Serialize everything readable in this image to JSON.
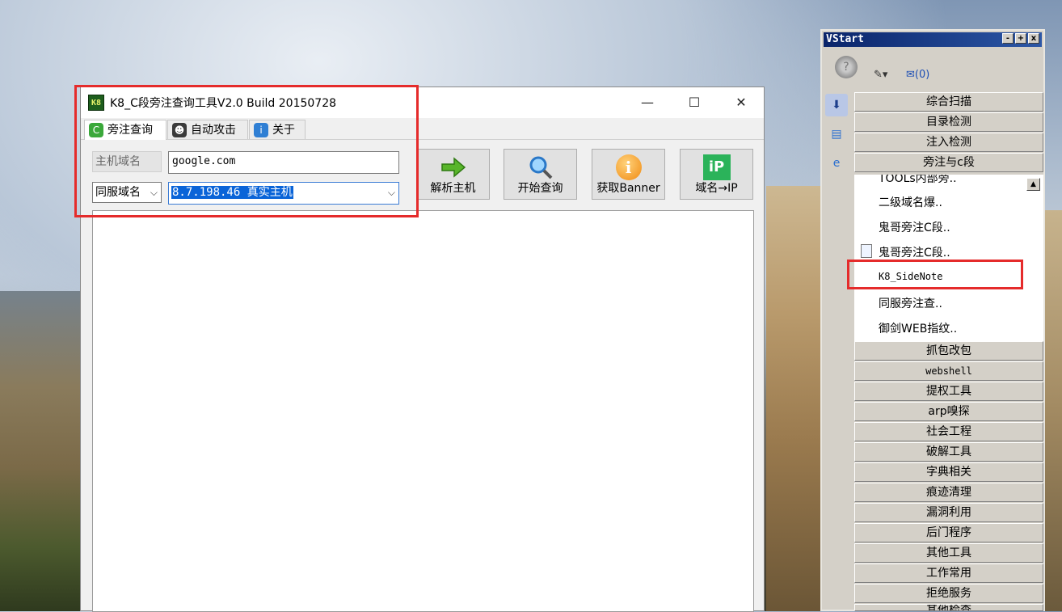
{
  "window": {
    "title": "K8_C段旁注查询工具V2.0  Build 20150728",
    "icon_text": "K8",
    "controls": {
      "minimize": "—",
      "maximize": "☐",
      "close": "✕"
    }
  },
  "tabs": [
    {
      "label": "旁注查询",
      "icon": "c-icon",
      "icon_glyph": "C"
    },
    {
      "label": "自动攻击",
      "icon": "hacker-icon",
      "icon_glyph": "☻"
    },
    {
      "label": "关于",
      "icon": "info-icon",
      "icon_glyph": "i"
    }
  ],
  "form": {
    "host_label": "主机域名",
    "host_value": "google.com",
    "mode_value": "同服域名",
    "ip_value": "8.7.198.46 真实主机",
    "arrow": "⌵"
  },
  "buttons": [
    {
      "label": "解析主机",
      "icon": "green-arrow-icon"
    },
    {
      "label": "开始查询",
      "icon": "magnifier-icon"
    },
    {
      "label": "获取Banner",
      "icon": "info-orange-icon",
      "glyph": "i"
    },
    {
      "label": "域名→IP",
      "icon": "ip-icon",
      "glyph": "iP"
    }
  ],
  "vstart": {
    "title": "VStart",
    "controls": {
      "min": "-",
      "max": "+",
      "close": "x"
    },
    "mail_count": "(0)",
    "top_categories": [
      "综合扫描",
      "目录检测",
      "注入检测",
      "旁注与c段"
    ],
    "list_items": [
      "TOOLs内部旁..",
      "二级域名爆..",
      "鬼哥旁注C段..",
      "鬼哥旁注C段..",
      "K8_SideNote",
      "同服旁注查..",
      "御剑WEB指纹.."
    ],
    "bottom_categories": [
      "抓包改包",
      "webshell",
      "提权工具",
      "arp嗅探",
      "社会工程",
      "破解工具",
      "字典相关",
      "痕迹清理",
      "漏洞利用",
      "后门程序",
      "其他工具",
      "工作常用",
      "拒绝服务",
      "其他检查"
    ],
    "scroll_glyph": "▲"
  },
  "colors": {
    "highlight": "#e52b2b",
    "selection": "#0a64d8",
    "vstart_title": "#0a246a"
  }
}
